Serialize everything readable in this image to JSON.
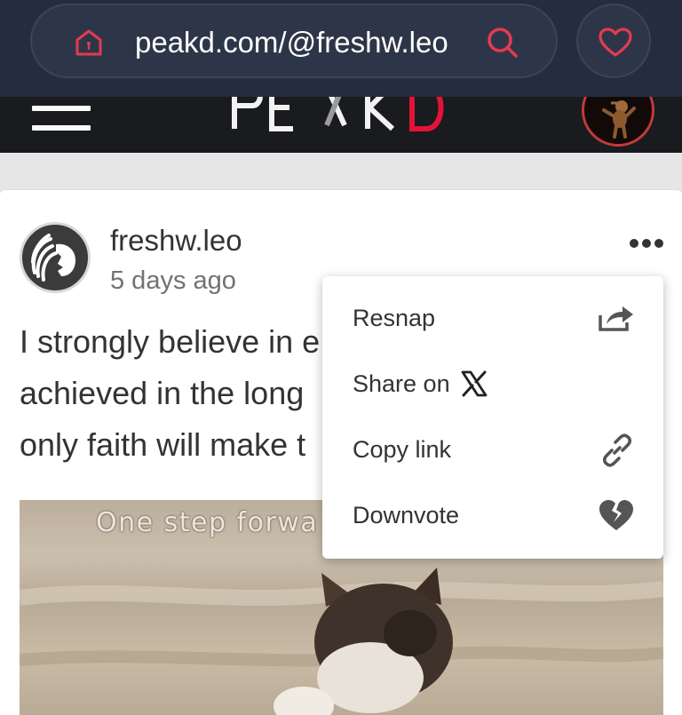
{
  "browser": {
    "url": "peakd.com/@freshw.leo",
    "icons": {
      "home": "home-shield-icon",
      "search": "search-icon",
      "favorite": "heart-icon"
    }
  },
  "header": {
    "logo_text": "PEAKD",
    "menu_icon": "hamburger-menu-icon"
  },
  "post": {
    "author": "freshw.leo",
    "time": "5 days ago",
    "body_lines": [
      "I strongly believe in e",
      "achieved in the long",
      "only faith will make t"
    ],
    "image_caption": "One step forwa"
  },
  "context_menu": {
    "items": [
      {
        "label": "Resnap",
        "icon": "share-arrow-icon"
      },
      {
        "label": "Share on",
        "icon": "x-logo-icon"
      },
      {
        "label": "Copy link",
        "icon": "link-icon"
      },
      {
        "label": "Downvote",
        "icon": "broken-heart-icon"
      }
    ]
  },
  "colors": {
    "browser_bar": "#242c3d",
    "accent_red": "#e31337",
    "header_bg": "#1a1b1e"
  }
}
